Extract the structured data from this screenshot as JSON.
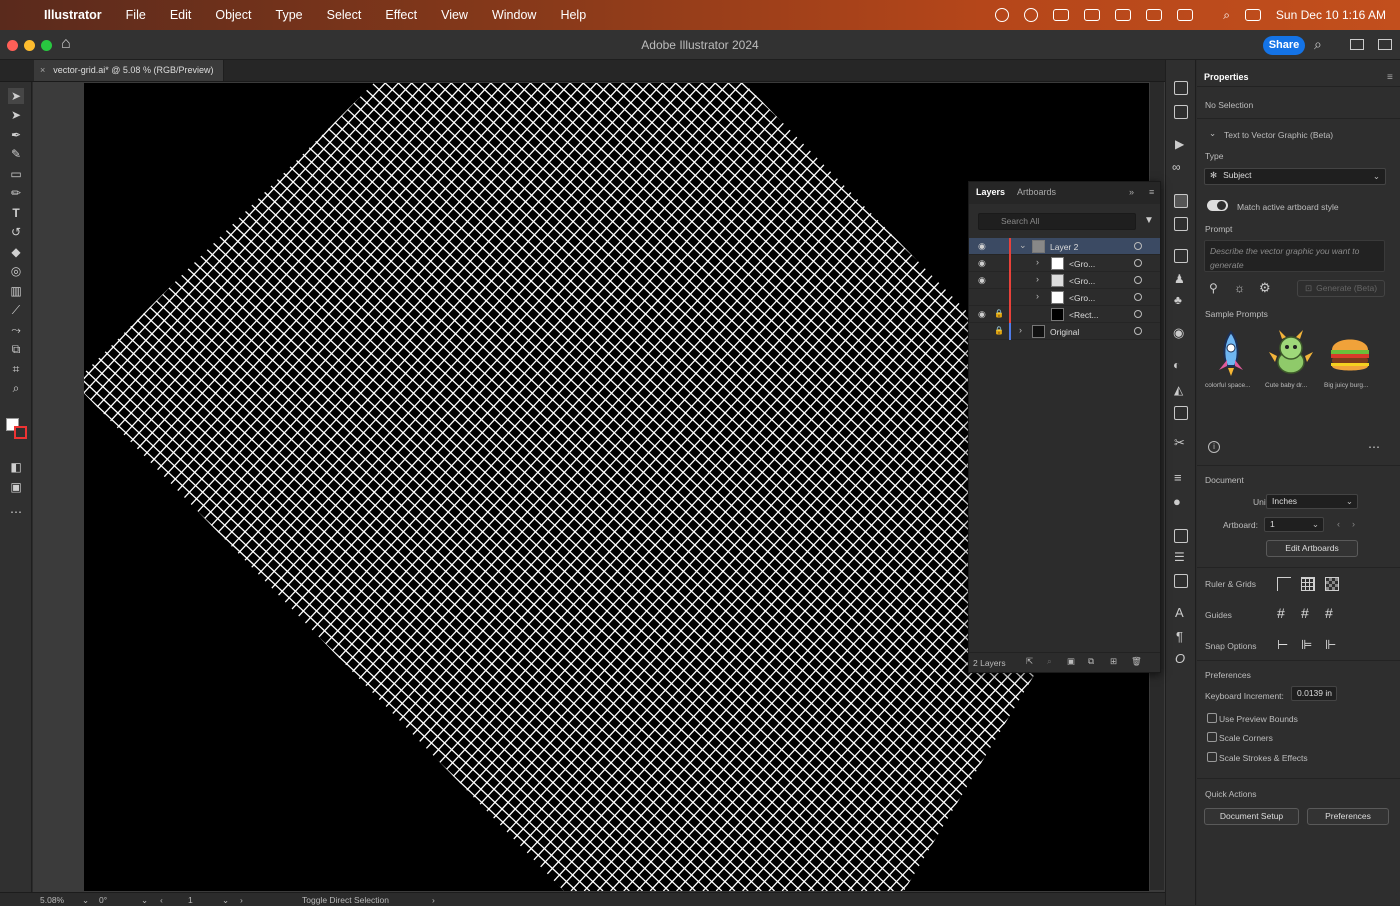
{
  "menubar": {
    "app": "Illustrator",
    "items": [
      "File",
      "Edit",
      "Object",
      "Type",
      "Select",
      "Effect",
      "View",
      "Window",
      "Help"
    ],
    "clock": "Sun Dec 10  1:16 AM"
  },
  "window": {
    "title": "Adobe Illustrator 2024",
    "share_label": "Share"
  },
  "document_tab": {
    "label": "vector-grid.ai* @ 5.08 % (RGB/Preview)",
    "close": "×"
  },
  "layers_panel": {
    "tabs": [
      "Layers",
      "Artboards"
    ],
    "search_placeholder": "Search All",
    "rows": [
      {
        "name": "Layer 2"
      },
      {
        "name": "<Gro..."
      },
      {
        "name": "<Gro..."
      },
      {
        "name": "<Gro..."
      },
      {
        "name": "<Rect..."
      },
      {
        "name": "Original"
      }
    ],
    "footer": "2 Layers"
  },
  "properties": {
    "title": "Properties",
    "no_selection": "No Selection",
    "t2v_title": "Text to Vector Graphic (Beta)",
    "type_label": "Type",
    "type_value": "Subject",
    "match_label": "Match active artboard style",
    "prompt_label": "Prompt",
    "prompt_placeholder": "Describe the vector graphic you want to generate",
    "generate_label": "Generate (Beta)",
    "sample_label": "Sample Prompts",
    "samples": [
      "colorful space...",
      "Cute baby dr...",
      "Big juicy burg..."
    ],
    "document_label": "Document",
    "units_label": "Units:",
    "units_value": "Inches",
    "artboard_label": "Artboard:",
    "artboard_value": "1",
    "edit_artboards": "Edit Artboards",
    "ruler_label": "Ruler & Grids",
    "guides_label": "Guides",
    "snap_label": "Snap Options",
    "prefs_label": "Preferences",
    "kbd_label": "Keyboard Increment:",
    "kbd_value": "0.0139 in",
    "checks": [
      "Use Preview Bounds",
      "Scale Corners",
      "Scale Strokes & Effects"
    ],
    "quick_label": "Quick Actions",
    "doc_setup": "Document Setup",
    "prefs_btn": "Preferences"
  },
  "statusbar": {
    "zoom": "5.08%",
    "rotate": "0°",
    "artboard": "1",
    "tool": "Toggle Direct Selection"
  },
  "colors": {
    "accent": "#1473e6",
    "layer_red": "#e8413a",
    "layer_blue": "#4f7be8",
    "canvas": "#000000",
    "grid": "#ffffff"
  }
}
